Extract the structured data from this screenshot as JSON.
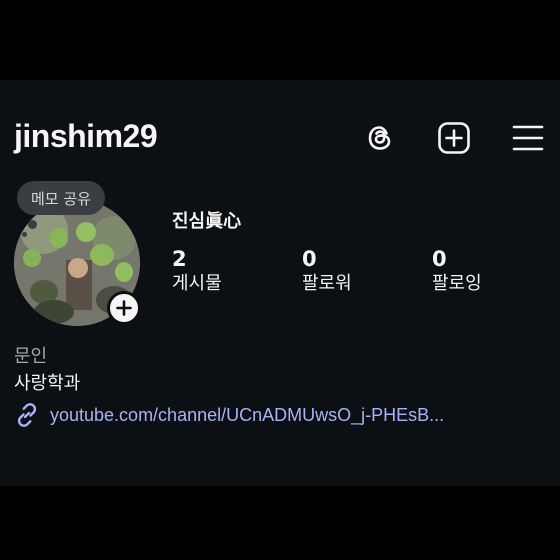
{
  "profile": {
    "username": "jinshim29",
    "display_name": "진심眞心",
    "note": "메모 공유",
    "category": "문인",
    "bio": "사랑학과",
    "link": "youtube.com/channel/UCnADMUwsO_j-PHEsB..."
  },
  "stats": [
    {
      "value": "2",
      "label": "게시물"
    },
    {
      "value": "0",
      "label": "팔로워"
    },
    {
      "value": "0",
      "label": "팔로잉"
    }
  ],
  "icons": {
    "threads": "threads-icon",
    "create": "create-post-icon",
    "menu": "hamburger-menu-icon",
    "link": "link-icon",
    "add_story": "plus-icon"
  },
  "colors": {
    "background": "#0c1014",
    "text": "#f5f5f5",
    "secondary_text": "#a8a8a8",
    "link": "#a7b3f5",
    "note_bubble": "#3a3d42"
  }
}
